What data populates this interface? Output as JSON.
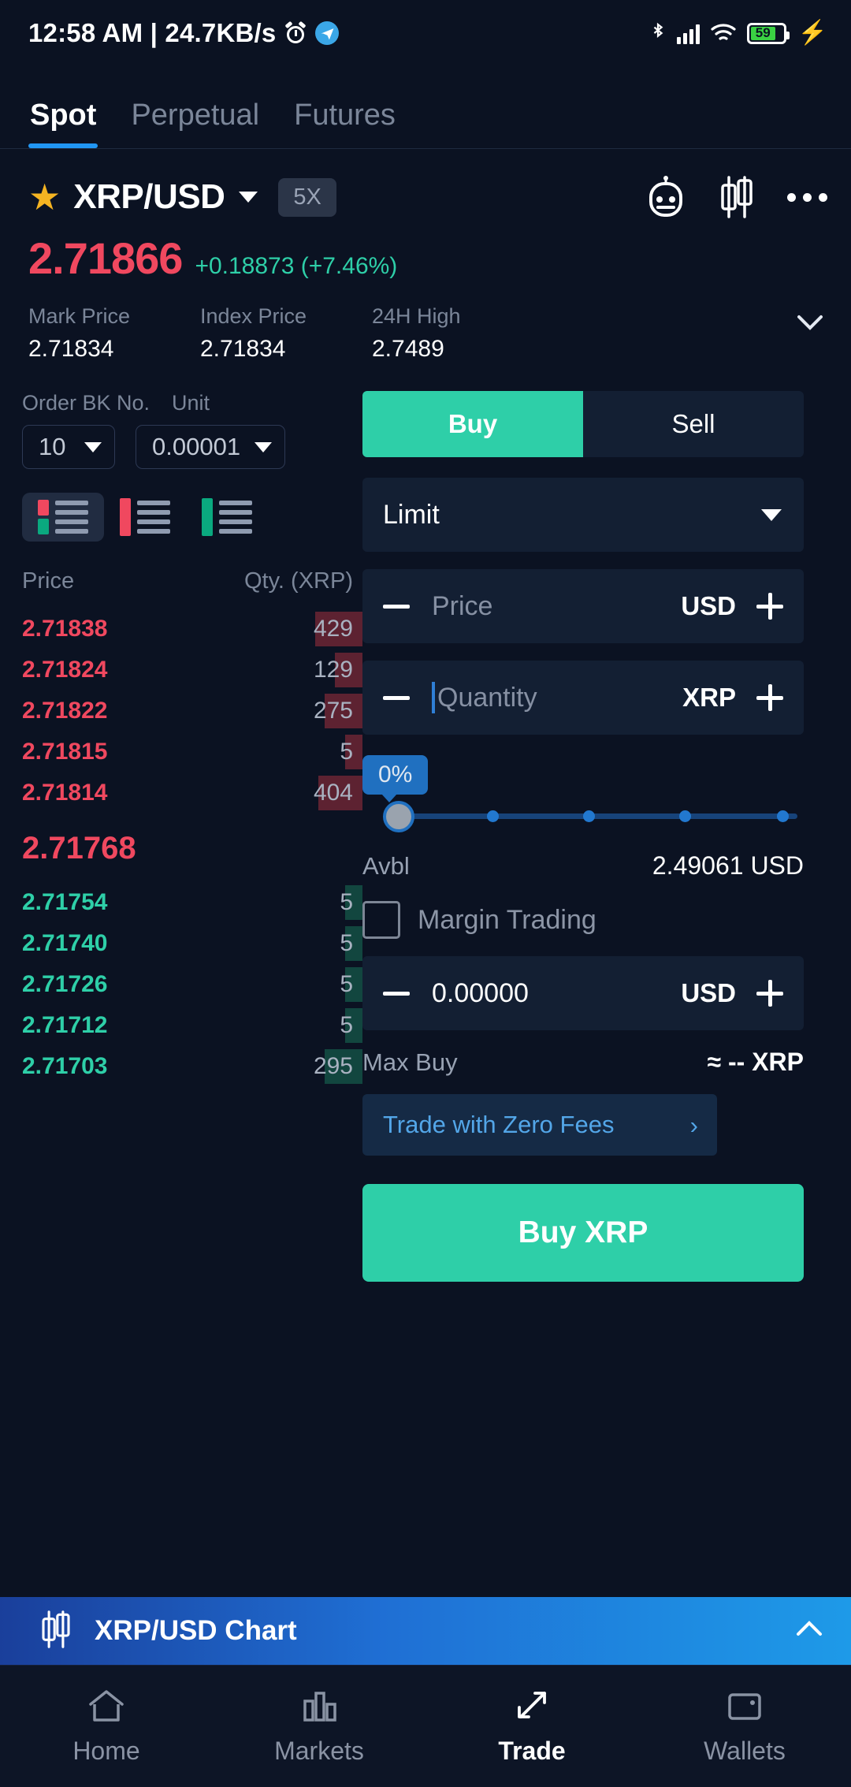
{
  "statusbar": {
    "time_text": "12:58 AM | 24.7KB/s",
    "alarm_icon": "alarm-clock-icon",
    "telegram_icon": "telegram-icon",
    "bluetooth_icon": "bluetooth-icon",
    "signal_icon": "cellular-signal-icon",
    "wifi_icon": "wifi-icon",
    "battery_level": "59",
    "charging_icon": "charging-bolt-icon"
  },
  "top_tabs": [
    {
      "label": "Spot",
      "active": true
    },
    {
      "label": "Perpetual",
      "active": false
    },
    {
      "label": "Futures",
      "active": false
    }
  ],
  "pair_header": {
    "favorite_icon": "star-icon",
    "pair": "XRP/USD",
    "dropdown_icon": "chevron-down-icon",
    "leverage": "5X",
    "bot_icon": "trading-bot-icon",
    "chart_icon": "candlestick-chart-icon",
    "more_icon": "more-options-icon"
  },
  "price": {
    "last": "2.71866",
    "change": "+0.18873 (+7.46%)",
    "last_color": "#f0485f",
    "change_color": "#2ecfa8"
  },
  "stats": [
    {
      "label": "Mark Price",
      "value": "2.71834"
    },
    {
      "label": "Index Price",
      "value": "2.71834"
    },
    {
      "label": "24H High",
      "value": "2.7489"
    }
  ],
  "stats_expand_icon": "chevron-down-icon",
  "orderbook_controls": {
    "bk_no_label": "Order BK No.",
    "unit_label": "Unit",
    "bk_no_value": "10",
    "unit_value": "0.00001",
    "view_both_icon": "depth-view-both-icon",
    "view_asks_icon": "depth-view-asks-icon",
    "view_bids_icon": "depth-view-bids-icon"
  },
  "orderbook": {
    "col_price": "Price",
    "col_qty": "Qty. (XRP)",
    "asks": [
      {
        "price": "2.71838",
        "qty": "429",
        "depth": 14
      },
      {
        "price": "2.71824",
        "qty": "129",
        "depth": 8
      },
      {
        "price": "2.71822",
        "qty": "275",
        "depth": 11
      },
      {
        "price": "2.71815",
        "qty": "5",
        "depth": 5
      },
      {
        "price": "2.71814",
        "qty": "404",
        "depth": 13
      }
    ],
    "mid_price": "2.71768",
    "bids": [
      {
        "price": "2.71754",
        "qty": "5",
        "depth": 5
      },
      {
        "price": "2.71740",
        "qty": "5",
        "depth": 5
      },
      {
        "price": "2.71726",
        "qty": "5",
        "depth": 5
      },
      {
        "price": "2.71712",
        "qty": "5",
        "depth": 5
      },
      {
        "price": "2.71703",
        "qty": "295",
        "depth": 11
      }
    ]
  },
  "trade_panel": {
    "buy_label": "Buy",
    "sell_label": "Sell",
    "order_type": "Limit",
    "order_type_icon": "chevron-down-icon",
    "price_placeholder": "Price",
    "price_unit": "USD",
    "quantity_placeholder": "Quantity",
    "quantity_unit": "XRP",
    "minus_icon": "minus-icon",
    "plus_icon": "plus-icon",
    "slider_percent": "0%",
    "avbl_label": "Avbl",
    "avbl_value": "2.49061 USD",
    "margin_label": "Margin Trading",
    "total_value": "0.00000",
    "total_unit": "USD",
    "max_label": "Max Buy",
    "max_value": "≈ -- XRP",
    "zero_fees_label": "Trade with Zero Fees",
    "zero_fees_arrow": "chevron-right-icon",
    "submit_label": "Buy XRP"
  },
  "chart_banner": {
    "icon": "candlestick-chart-icon",
    "label": "XRP/USD Chart",
    "expand_icon": "chevron-up-icon"
  },
  "bottom_nav": [
    {
      "label": "Home",
      "icon": "home-icon",
      "active": false
    },
    {
      "label": "Markets",
      "icon": "bar-chart-icon",
      "active": false
    },
    {
      "label": "Trade",
      "icon": "trade-arrows-icon",
      "active": true
    },
    {
      "label": "Wallets",
      "icon": "wallet-icon",
      "active": false
    }
  ]
}
